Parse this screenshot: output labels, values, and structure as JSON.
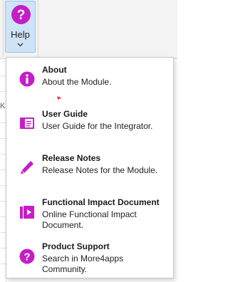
{
  "ribbon": {
    "help_label": "Help",
    "cut_label": "on",
    "left_mark": "K"
  },
  "menu": {
    "items": [
      {
        "title": "About",
        "desc": "About the Module.",
        "icon": "info-icon"
      },
      {
        "title": "User Guide",
        "desc": "User Guide for the Integrator.",
        "icon": "book-icon"
      },
      {
        "title": "Release Notes",
        "desc": "Release Notes for the Module.",
        "icon": "pen-icon"
      },
      {
        "title": "Functional Impact Document",
        "desc": "Online Functional Impact Document.",
        "icon": "document-play-icon"
      },
      {
        "title": "Product Support",
        "desc": "Search in More4apps Community.",
        "icon": "question-icon"
      }
    ]
  },
  "colors": {
    "accent": "#c41ec6",
    "button_bg": "#cfe3f7",
    "button_border": "#9cc3ea"
  }
}
